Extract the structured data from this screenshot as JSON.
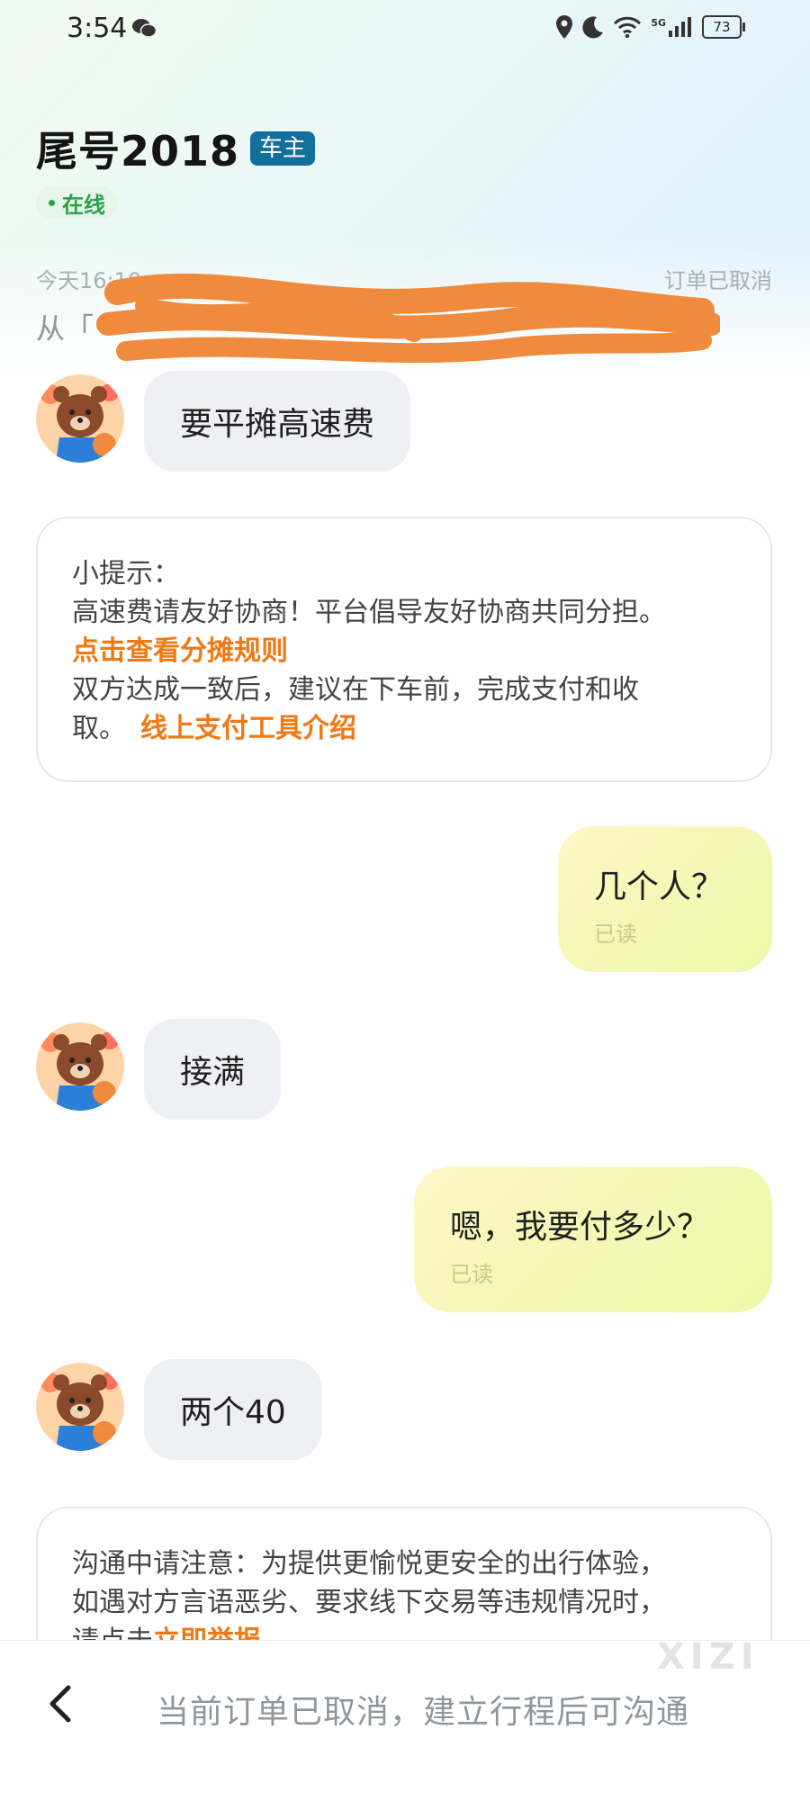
{
  "status_bar": {
    "time": "3:54",
    "battery": "73",
    "network": "5G"
  },
  "header": {
    "title": "尾号2018",
    "role_badge": "车主",
    "online_status": "在线",
    "order_time": "今天16:10",
    "order_status": "订单已取消",
    "route_prefix": "从「"
  },
  "messages": [
    {
      "side": "left",
      "text": "要平摊高速费"
    },
    {
      "side": "right",
      "text": "几个人？",
      "read_label": "已读"
    },
    {
      "side": "left",
      "text": "接满"
    },
    {
      "side": "right",
      "text": "嗯，我要付多少？",
      "read_label": "已读"
    },
    {
      "side": "left",
      "text": "两个40"
    }
  ],
  "tip_card": {
    "heading": "小提示：",
    "line1": "高速费请友好协商！平台倡导友好协商共同分担。",
    "link_rules": "点击查看分摊规则",
    "line2": "双方达成一致后，建议在下车前，完成支付和收",
    "line3": "取。",
    "link_pay": "线上支付工具介绍"
  },
  "notice_card": {
    "line1": "沟通中请注意：为提供更愉悦更安全的出行体验，",
    "line2": "如遇对方言语恶劣、要求线下交易等违规情况时，",
    "line3_prefix": "请点击",
    "link_report": "立即举报"
  },
  "bottom_bar": {
    "text": "当前订单已取消，建立行程后可沟通"
  },
  "watermark": "XIZI",
  "colors": {
    "accent_orange": "#f07914",
    "badge_blue": "#136f9c",
    "online_green": "#29a34a",
    "scribble": "#f08a3c"
  }
}
